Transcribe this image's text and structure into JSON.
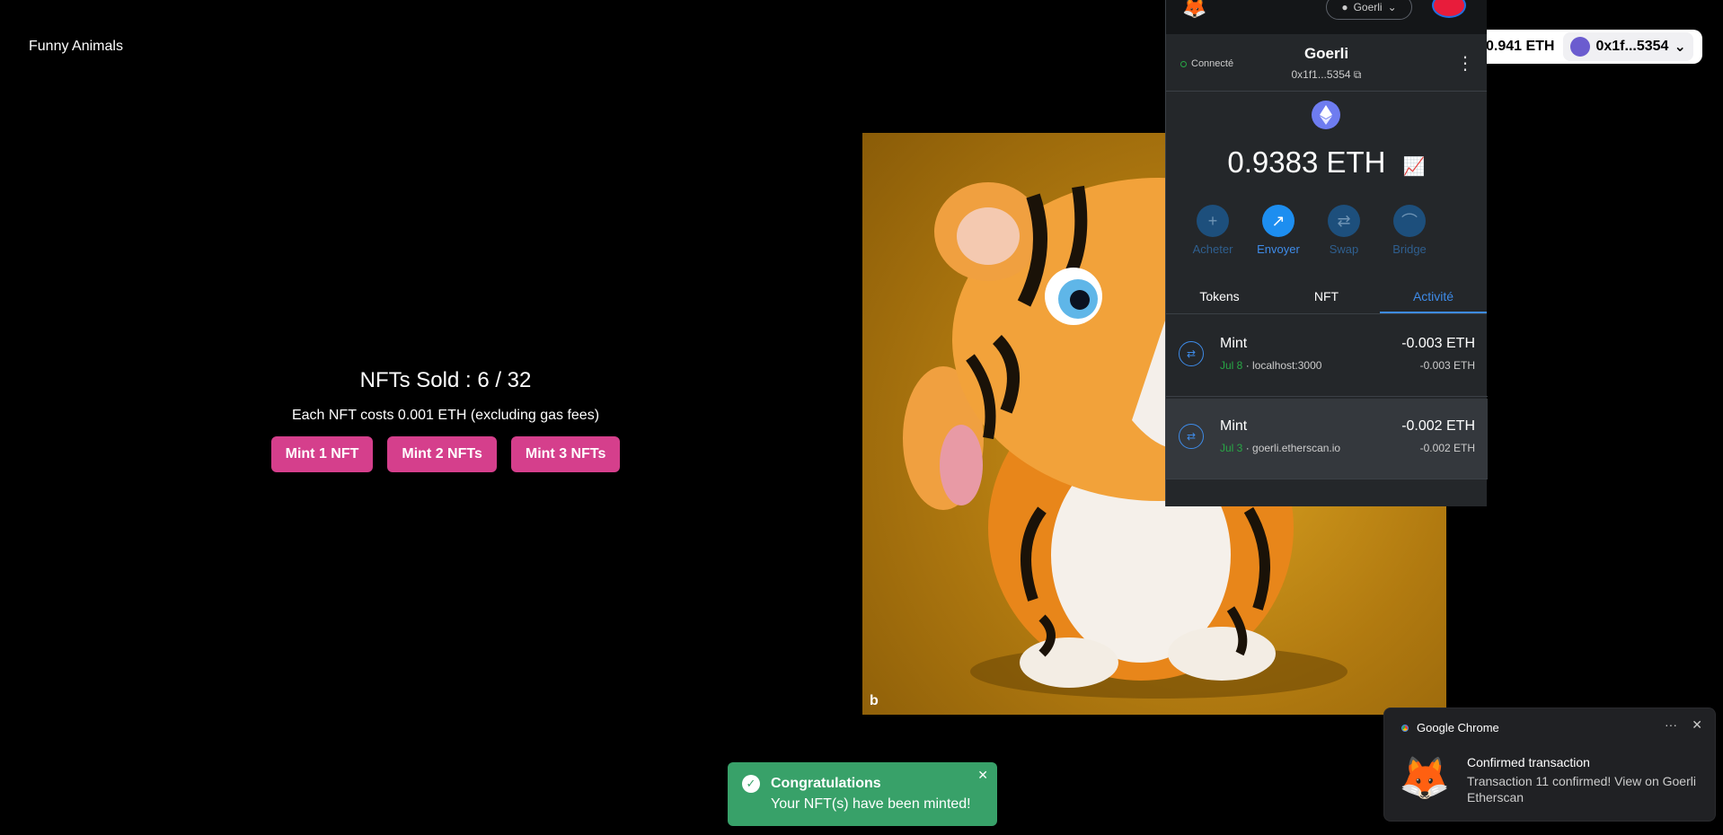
{
  "app": {
    "title": "Funny Animals"
  },
  "sale": {
    "sold_text": "NFTs Sold : 6 / 32",
    "cost_text": "Each NFT costs 0.001 ETH (excluding gas fees)",
    "buttons": [
      "Mint 1 NFT",
      "Mint 2 NFTs",
      "Mint 3 NFTs"
    ]
  },
  "nft_image": {
    "subject": "tiger-cub-illustration",
    "logo_glyph": "b"
  },
  "wallet": {
    "balance": "0.941 ETH",
    "address": "0x1f...5354",
    "chevron": "chevron-down-icon"
  },
  "metamask": {
    "network": "Goerli",
    "status": "Connecté",
    "account_name": "Goerli",
    "account_address": "0x1f1...5354",
    "balance": "0.9383 ETH",
    "actions": [
      {
        "label": "Acheter",
        "icon": "plus-icon",
        "glyph": "+"
      },
      {
        "label": "Envoyer",
        "icon": "send-arrow-icon",
        "glyph": "↗"
      },
      {
        "label": "Swap",
        "icon": "swap-icon",
        "glyph": "⇄"
      },
      {
        "label": "Bridge",
        "icon": "bridge-icon",
        "glyph": "⌒"
      }
    ],
    "tabs": [
      "Tokens",
      "NFT",
      "Activité"
    ],
    "active_tab": "Activité",
    "transactions": [
      {
        "title": "Mint",
        "date": "Jul 8",
        "origin": "localhost:3000",
        "amount": "-0.003 ETH",
        "amount_fiat": "-0.003 ETH"
      },
      {
        "title": "Mint",
        "date": "Jul 3",
        "origin": "goerli.etherscan.io",
        "amount": "-0.002 ETH",
        "amount_fiat": "-0.002 ETH"
      }
    ]
  },
  "toast": {
    "title": "Congratulations",
    "description": "Your NFT(s) have been minted!"
  },
  "notification": {
    "app": "Google Chrome",
    "title": "Confirmed transaction",
    "body": "Transaction 11 confirmed! View on Goerli Etherscan"
  },
  "colors": {
    "mint_button": "#d53f8c",
    "toast": "#38a169",
    "metamask_bg": "#24272a",
    "accent_blue": "#3e8be8"
  }
}
